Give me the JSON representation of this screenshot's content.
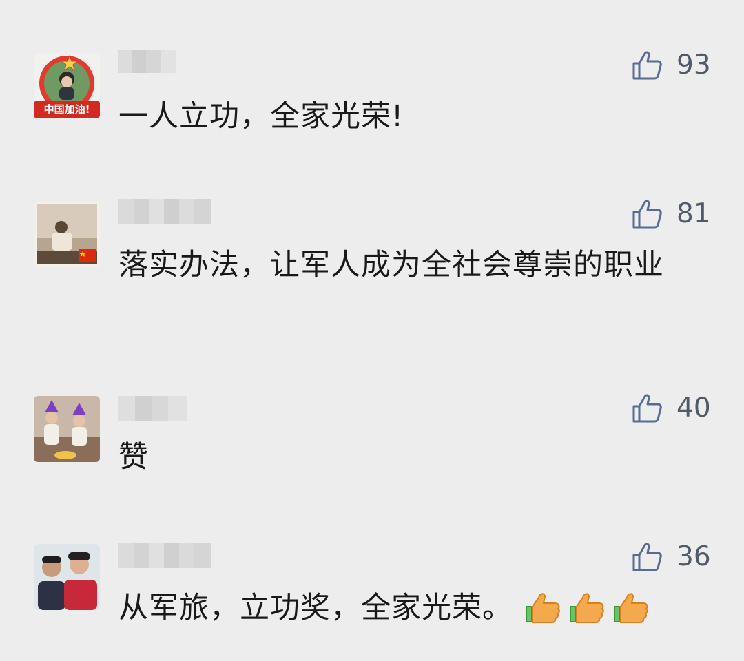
{
  "comments": [
    {
      "text": "一人立功，全家光荣!",
      "likes": "93",
      "avatar_badge": "中国加油!"
    },
    {
      "text": "落实办法，让军人成为全社会尊崇的职业",
      "likes": "81"
    },
    {
      "text": "赞",
      "likes": "40"
    },
    {
      "text": "从军旅，立功奖，全家光荣。",
      "likes": "36",
      "emojis": [
        "thumbs-up-emoji",
        "thumbs-up-emoji",
        "thumbs-up-emoji"
      ]
    }
  ],
  "colors": {
    "background": "#ededed",
    "like_icon": "#576b95",
    "like_count": "#505a68",
    "text": "#191919",
    "badge_red": "#d22a20"
  },
  "icons": {
    "like": "thumbs-up-outline-icon"
  }
}
